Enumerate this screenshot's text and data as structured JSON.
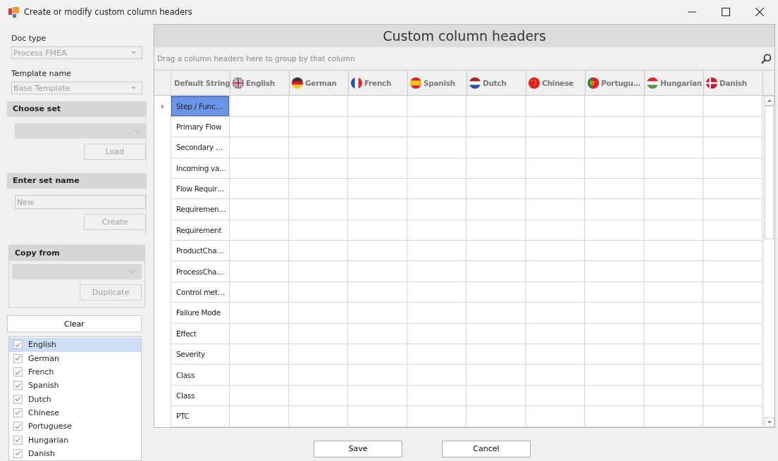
{
  "window": {
    "title": "Create or modify custom column headers"
  },
  "left_panel": {
    "doc_type": {
      "label": "Doc type",
      "value": "Process FMEA",
      "disabled": true
    },
    "template_name": {
      "label": "Template name",
      "value": "Base Template",
      "disabled": true
    },
    "choose_set": {
      "title": "Choose set",
      "button": "Load",
      "disabled": true
    },
    "enter_set_name": {
      "title": "Enter set name",
      "value": "New",
      "button": "Create",
      "disabled": true
    },
    "copy_from": {
      "title": "Copy from",
      "button": "Duplicate",
      "disabled": true
    },
    "clear_button": "Clear",
    "languages": [
      {
        "label": "English",
        "checked": true,
        "selected": true
      },
      {
        "label": "German",
        "checked": true,
        "selected": false
      },
      {
        "label": "French",
        "checked": true,
        "selected": false
      },
      {
        "label": "Spanish",
        "checked": true,
        "selected": false
      },
      {
        "label": "Dutch",
        "checked": true,
        "selected": false
      },
      {
        "label": "Chinese",
        "checked": true,
        "selected": false
      },
      {
        "label": "Portuguese",
        "checked": true,
        "selected": false
      },
      {
        "label": "Hungarian",
        "checked": true,
        "selected": false
      },
      {
        "label": "Danish",
        "checked": true,
        "selected": false
      }
    ]
  },
  "grid": {
    "title": "Custom column headers",
    "group_panel_hint": "Drag a column headers here to group by that column",
    "columns": [
      "Default String",
      "English",
      "German",
      "French",
      "Spanish",
      "Dutch",
      "Chinese",
      "Portugu…",
      "Hungarian",
      "Danish"
    ],
    "rows": [
      {
        "default": "Step / Func…",
        "selected": true
      },
      {
        "default": "Primary Flow",
        "selected": false
      },
      {
        "default": "Secondary …",
        "selected": false
      },
      {
        "default": "Incoming va…",
        "selected": false
      },
      {
        "default": "Flow Requir…",
        "selected": false
      },
      {
        "default": "Requiremen…",
        "selected": false
      },
      {
        "default": "Requirement",
        "selected": false
      },
      {
        "default": "ProductCha…",
        "selected": false
      },
      {
        "default": "ProcessCha…",
        "selected": false
      },
      {
        "default": "Control met…",
        "selected": false
      },
      {
        "default": "Failure Mode",
        "selected": false
      },
      {
        "default": "Effect",
        "selected": false
      },
      {
        "default": "Severity",
        "selected": false
      },
      {
        "default": "Class",
        "selected": false
      },
      {
        "default": "Class",
        "selected": false
      },
      {
        "default": "PTC",
        "selected": false
      }
    ]
  },
  "buttons": [
    "Save",
    "Cancel"
  ]
}
